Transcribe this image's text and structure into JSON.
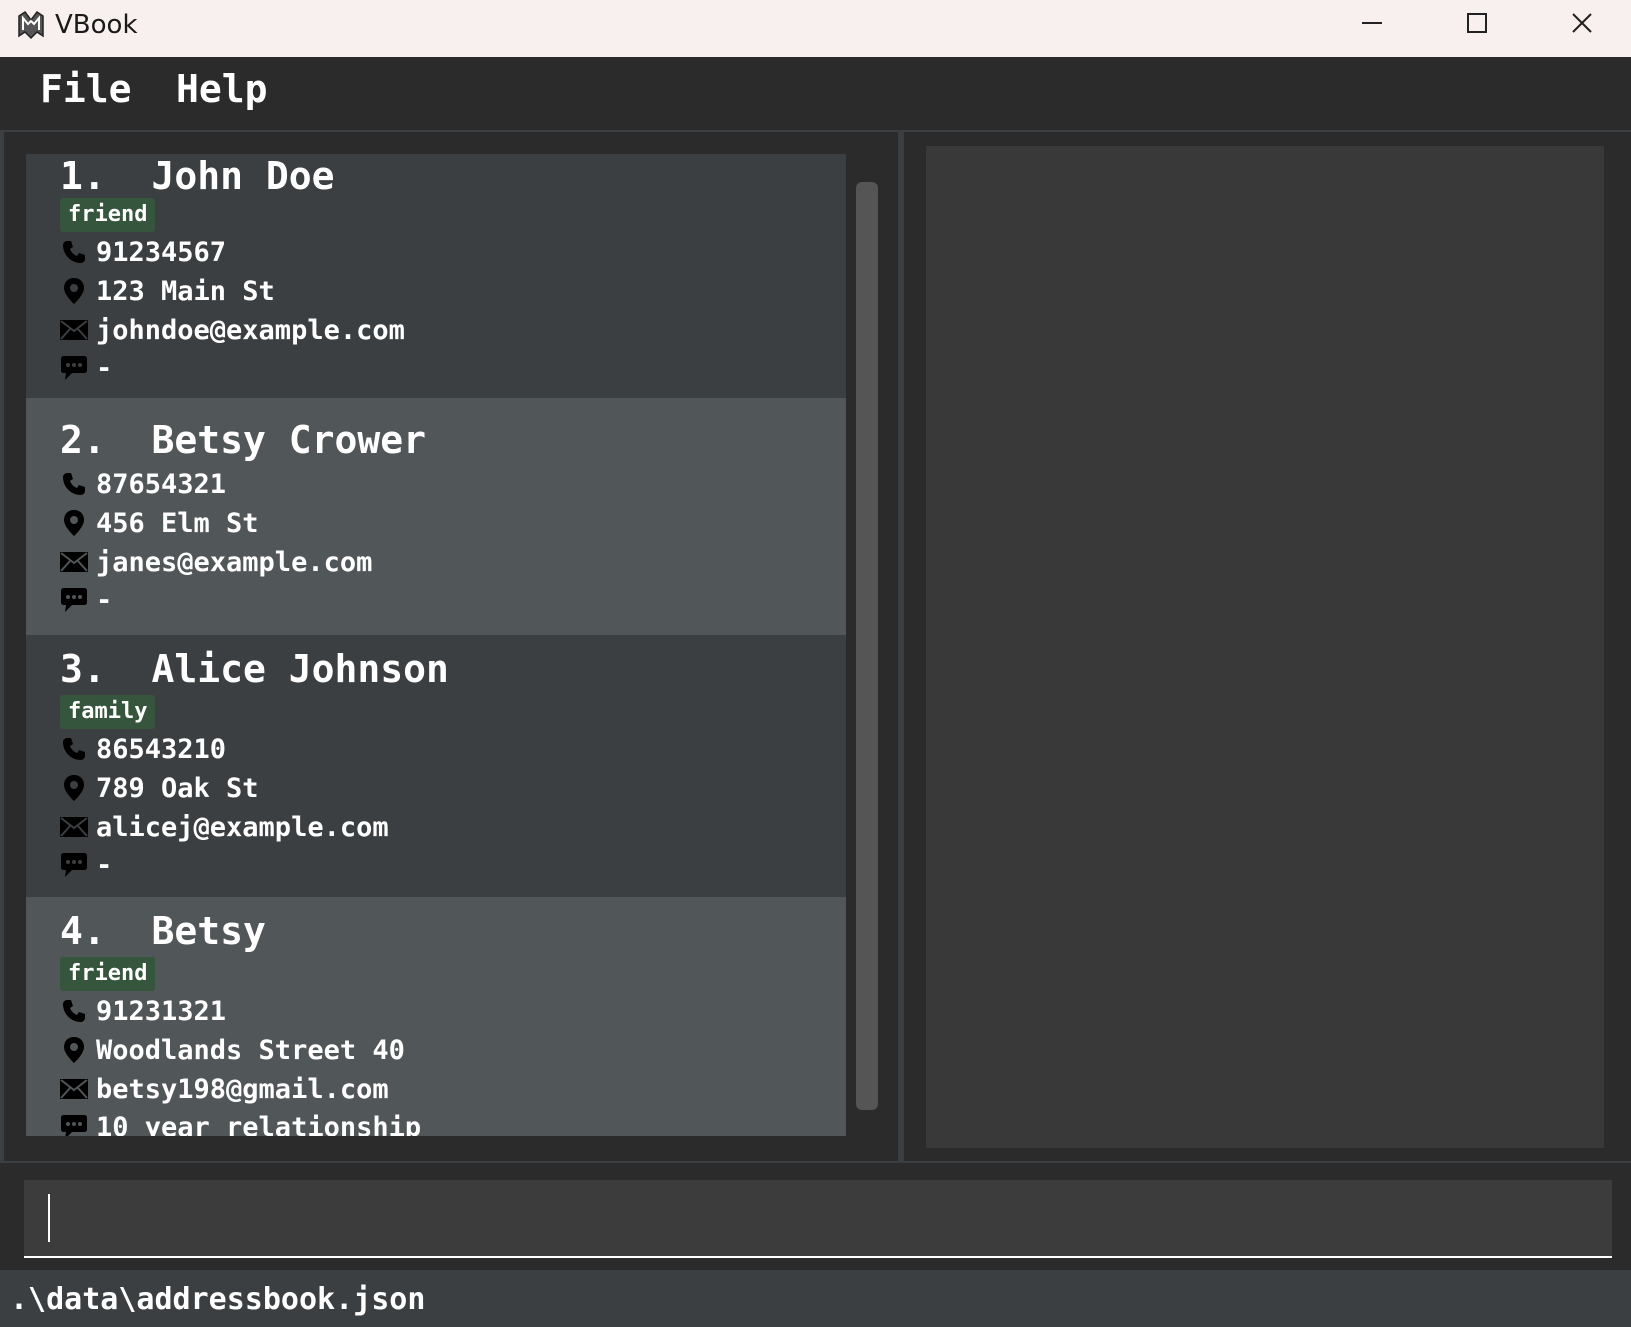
{
  "window": {
    "title": "VBook",
    "icon": "vbook-logo-icon",
    "controls": [
      "minimize-icon",
      "maximize-icon",
      "close-icon"
    ]
  },
  "menu": {
    "file": "File",
    "help": "Help"
  },
  "contacts": [
    {
      "title": "1.  John Doe",
      "tag": "friend",
      "phone": "91234567",
      "address": "123 Main St",
      "email": "johndoe@example.com",
      "remark": "-"
    },
    {
      "title": "2.  Betsy Crower",
      "phone": "87654321",
      "address": "456 Elm St",
      "email": "janes@example.com",
      "remark": "-"
    },
    {
      "title": "3.  Alice Johnson",
      "tag": "family",
      "phone": "86543210",
      "address": "789 Oak St",
      "email": "alicej@example.com",
      "remark": "-"
    },
    {
      "title": "4.  Betsy",
      "tag": "friend",
      "phone": "91231321",
      "address": "Woodlands Street 40",
      "email": "betsy198@gmail.com",
      "remark": "10 year relationship"
    }
  ],
  "command": {
    "value": ""
  },
  "status": {
    "file_path": ".\\data\\addressbook.json"
  },
  "colors": {
    "background": "#2b2b2b",
    "card_odd": "#3c3f41",
    "card_even": "#515658",
    "tag": "#36553d",
    "titlebar": "#f8f0ee"
  }
}
